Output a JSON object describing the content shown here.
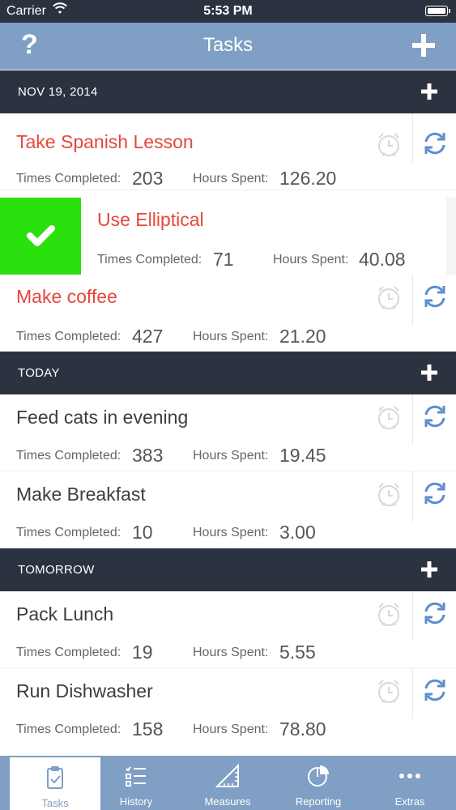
{
  "status": {
    "carrier": "Carrier",
    "time": "5:53 PM"
  },
  "nav": {
    "title": "Tasks",
    "help": "?"
  },
  "sections": [
    {
      "label": "NOV 19, 2014"
    },
    {
      "label": "TODAY"
    },
    {
      "label": "TOMORROW"
    }
  ],
  "stat_labels": {
    "completed": "Times Completed:",
    "hours": "Hours Spent:"
  },
  "tasks": [
    {
      "name": "Take Spanish Lesson",
      "completed": "203",
      "hours": "126.20",
      "overdue": true
    },
    {
      "name": "Use Elliptical",
      "completed": "71",
      "hours": "40.08",
      "overdue": true
    },
    {
      "name": "Make coffee",
      "completed": "427",
      "hours": "21.20",
      "overdue": true
    },
    {
      "name": "Feed cats in evening",
      "completed": "383",
      "hours": "19.45",
      "overdue": false
    },
    {
      "name": "Make Breakfast",
      "completed": "10",
      "hours": "3.00",
      "overdue": false
    },
    {
      "name": "Pack Lunch",
      "completed": "19",
      "hours": "5.55",
      "overdue": false
    },
    {
      "name": "Run Dishwasher",
      "completed": "158",
      "hours": "78.80",
      "overdue": false
    }
  ],
  "tabs": [
    {
      "label": "Tasks",
      "icon": "clipboard-check-icon",
      "active": true
    },
    {
      "label": "History",
      "icon": "checklist-icon",
      "active": false
    },
    {
      "label": "Measures",
      "icon": "ruler-triangle-icon",
      "active": false
    },
    {
      "label": "Reporting",
      "icon": "pie-chart-icon",
      "active": false
    },
    {
      "label": "Extras",
      "icon": "more-dots-icon",
      "active": false
    }
  ],
  "colors": {
    "nav_bar": "#7f9fc4",
    "section_header": "#2c3340",
    "overdue_text": "#e5473b",
    "complete_action": "#2ae00d",
    "sync_icon": "#5a8ed0"
  }
}
